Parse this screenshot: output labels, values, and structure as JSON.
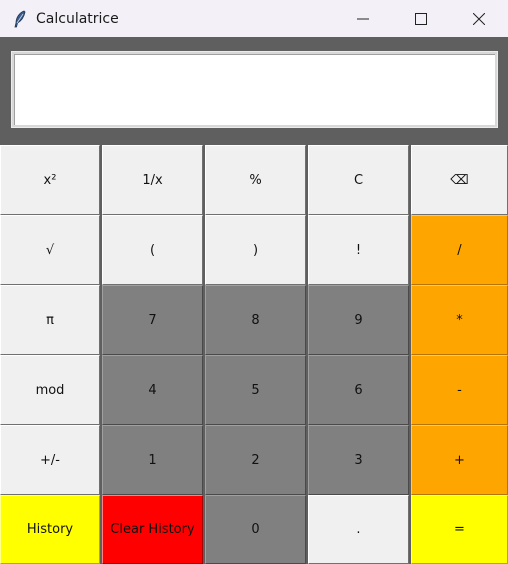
{
  "window": {
    "title": "Calculatrice",
    "controls": [
      "minimize-icon",
      "maximize-icon",
      "close-icon"
    ]
  },
  "display": {
    "value": ""
  },
  "keys": {
    "row1": [
      "x²",
      "1/x",
      "%",
      "C",
      "⌫"
    ],
    "row2": [
      "√",
      "(",
      ")",
      "!",
      "/"
    ],
    "row3": [
      "π",
      "7",
      "8",
      "9",
      "*"
    ],
    "row4": [
      "mod",
      "4",
      "5",
      "6",
      "-"
    ],
    "row5": [
      "+/-",
      "1",
      "2",
      "3",
      "+"
    ],
    "row6": [
      "History",
      "Clear History",
      "0",
      ".",
      "="
    ]
  },
  "colors": {
    "light": "#f0f0f0",
    "dark": "#808080",
    "orange": "#ffa500",
    "yellow": "#ffff00",
    "red": "#ff0000",
    "background": "#5f5f5f"
  }
}
